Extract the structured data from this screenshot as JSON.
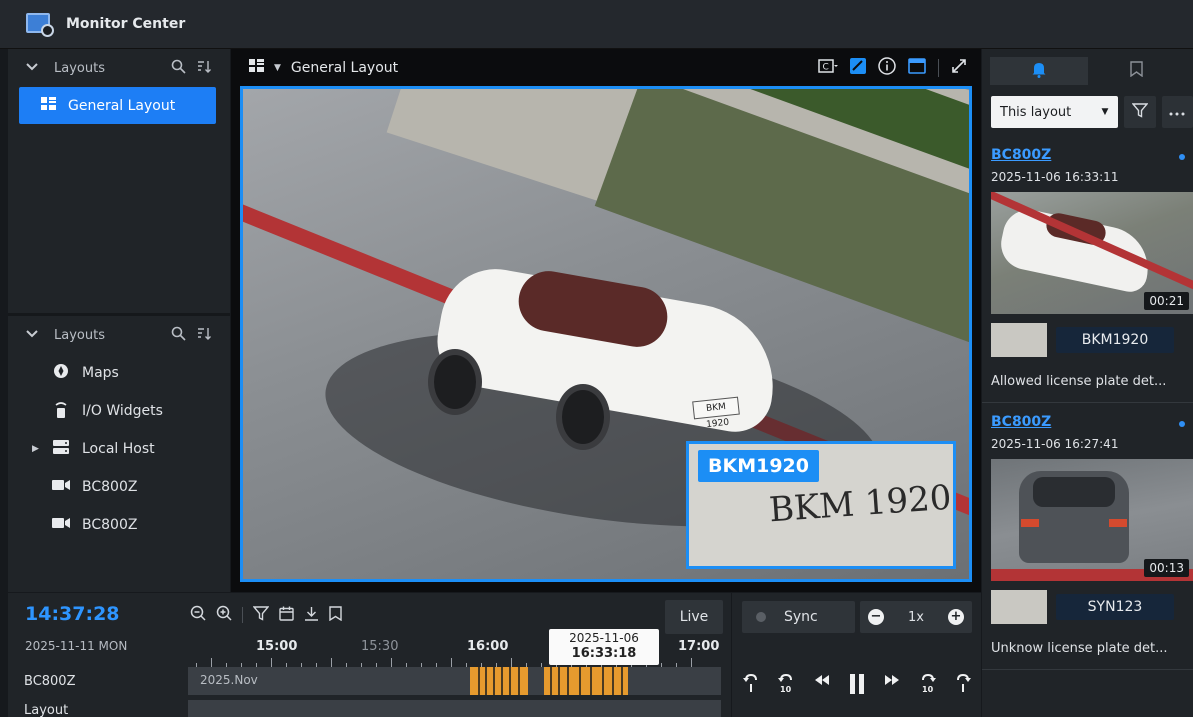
{
  "app": {
    "title": "Monitor Center"
  },
  "left": {
    "section1_title": "Layouts",
    "layout_item": "General Layout",
    "section2_title": "Layouts",
    "tree": [
      "Maps",
      "I/O Widgets",
      "Local Host",
      "BC800Z",
      "BC800Z"
    ]
  },
  "center": {
    "layout_name": "General Layout",
    "plate_label": "BKM1920",
    "plate_zoom_text": "BKM 1920",
    "car_plate_text": "BKM 1920"
  },
  "right": {
    "filter_select": "This layout",
    "events": [
      {
        "camera": "BC800Z",
        "timestamp": "2025-11-06 16:33:11",
        "duration": "00:21",
        "plate": "BKM1920",
        "description": "Allowed license plate det..."
      },
      {
        "camera": "BC800Z",
        "timestamp": "2025-11-06 16:27:41",
        "duration": "00:13",
        "plate": "SYN123",
        "description": "Unknow license plate det..."
      }
    ]
  },
  "timeline": {
    "clock": "14:37:28",
    "date": "2025-11-11 MON",
    "live_label": "Live",
    "ticks": [
      "15:00",
      "15:30",
      "16:00",
      "17:00"
    ],
    "cursor_date": "2025-11-06",
    "cursor_time": "16:33:18",
    "rows": [
      {
        "label": "BC800Z",
        "month": "2025.Nov"
      },
      {
        "label": "Layout"
      }
    ]
  },
  "playback": {
    "sync_label": "Sync",
    "speed": "1x",
    "minus": "−",
    "plus": "+"
  },
  "colors": {
    "accent": "#1c8ef5",
    "recording": "#e69a2e",
    "clock": "#2e95ff"
  }
}
